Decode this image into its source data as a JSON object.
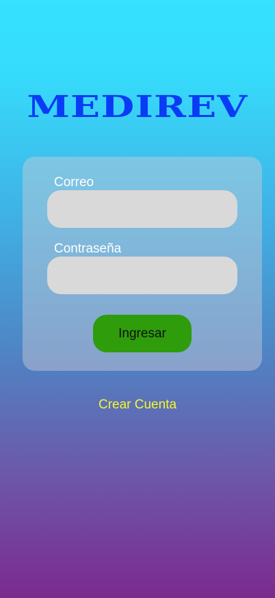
{
  "app": {
    "title": "MEDIREV"
  },
  "login_form": {
    "email_label": "Correo",
    "email_value": "",
    "password_label": "Contraseña",
    "password_value": "",
    "submit_label": "Ingresar"
  },
  "create_account": {
    "label": "Crear Cuenta"
  },
  "colors": {
    "title": "#0a3cf5",
    "submit_button": "#2e9c0b",
    "link": "#f7f72a",
    "input_background": "#d9d9d9",
    "gradient_top": "#35e1ff",
    "gradient_bottom": "#7b2a8e"
  }
}
